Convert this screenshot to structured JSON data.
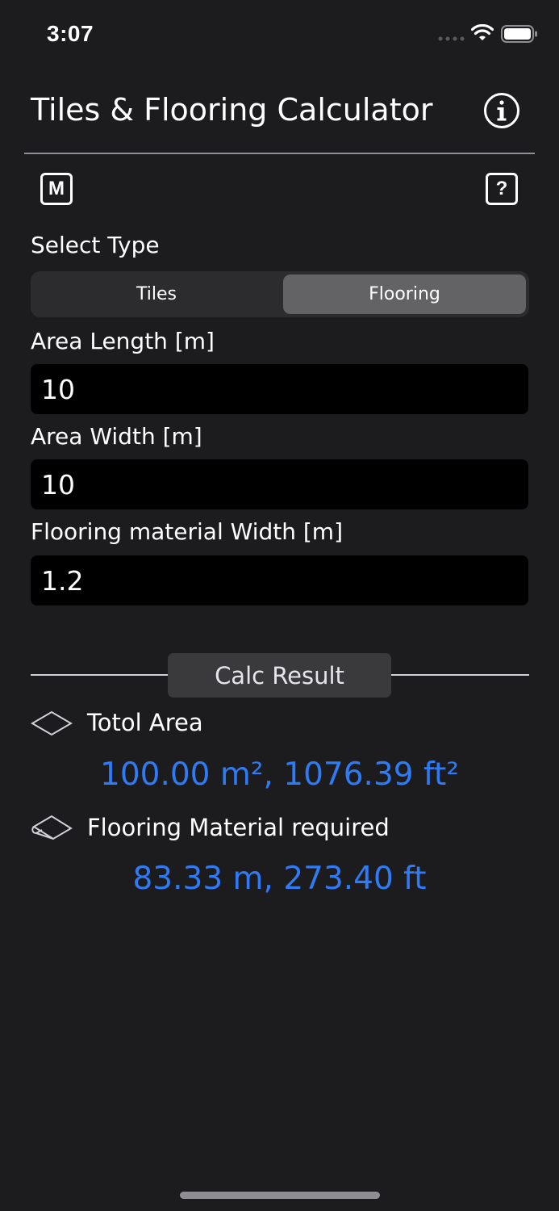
{
  "status_bar": {
    "time": "3:07"
  },
  "header": {
    "title": "Tiles & Flooring Calculator",
    "info_icon": "info-circle-icon"
  },
  "toolbar": {
    "m_label": "M",
    "help_label": "?"
  },
  "select_type": {
    "label": "Select Type",
    "options": [
      "Tiles",
      "Flooring"
    ],
    "selected": "Flooring"
  },
  "fields": [
    {
      "label": "Area Length [m]",
      "value": "10"
    },
    {
      "label": "Area Width [m]",
      "value": "10"
    },
    {
      "label": "Flooring material Width [m]",
      "value": "1.2"
    }
  ],
  "results": {
    "button_label": "Calc Result",
    "total_area_label": "Totol Area",
    "total_area_value": "100.00 m², 1076.39 ft²",
    "material_label": "Flooring Material required",
    "material_value": "83.33 m, 273.40 ft"
  },
  "colors": {
    "background": "#1c1c1e",
    "accent": "#2f7bf5",
    "input_bg": "#000000",
    "segment_selected": "#636366"
  }
}
